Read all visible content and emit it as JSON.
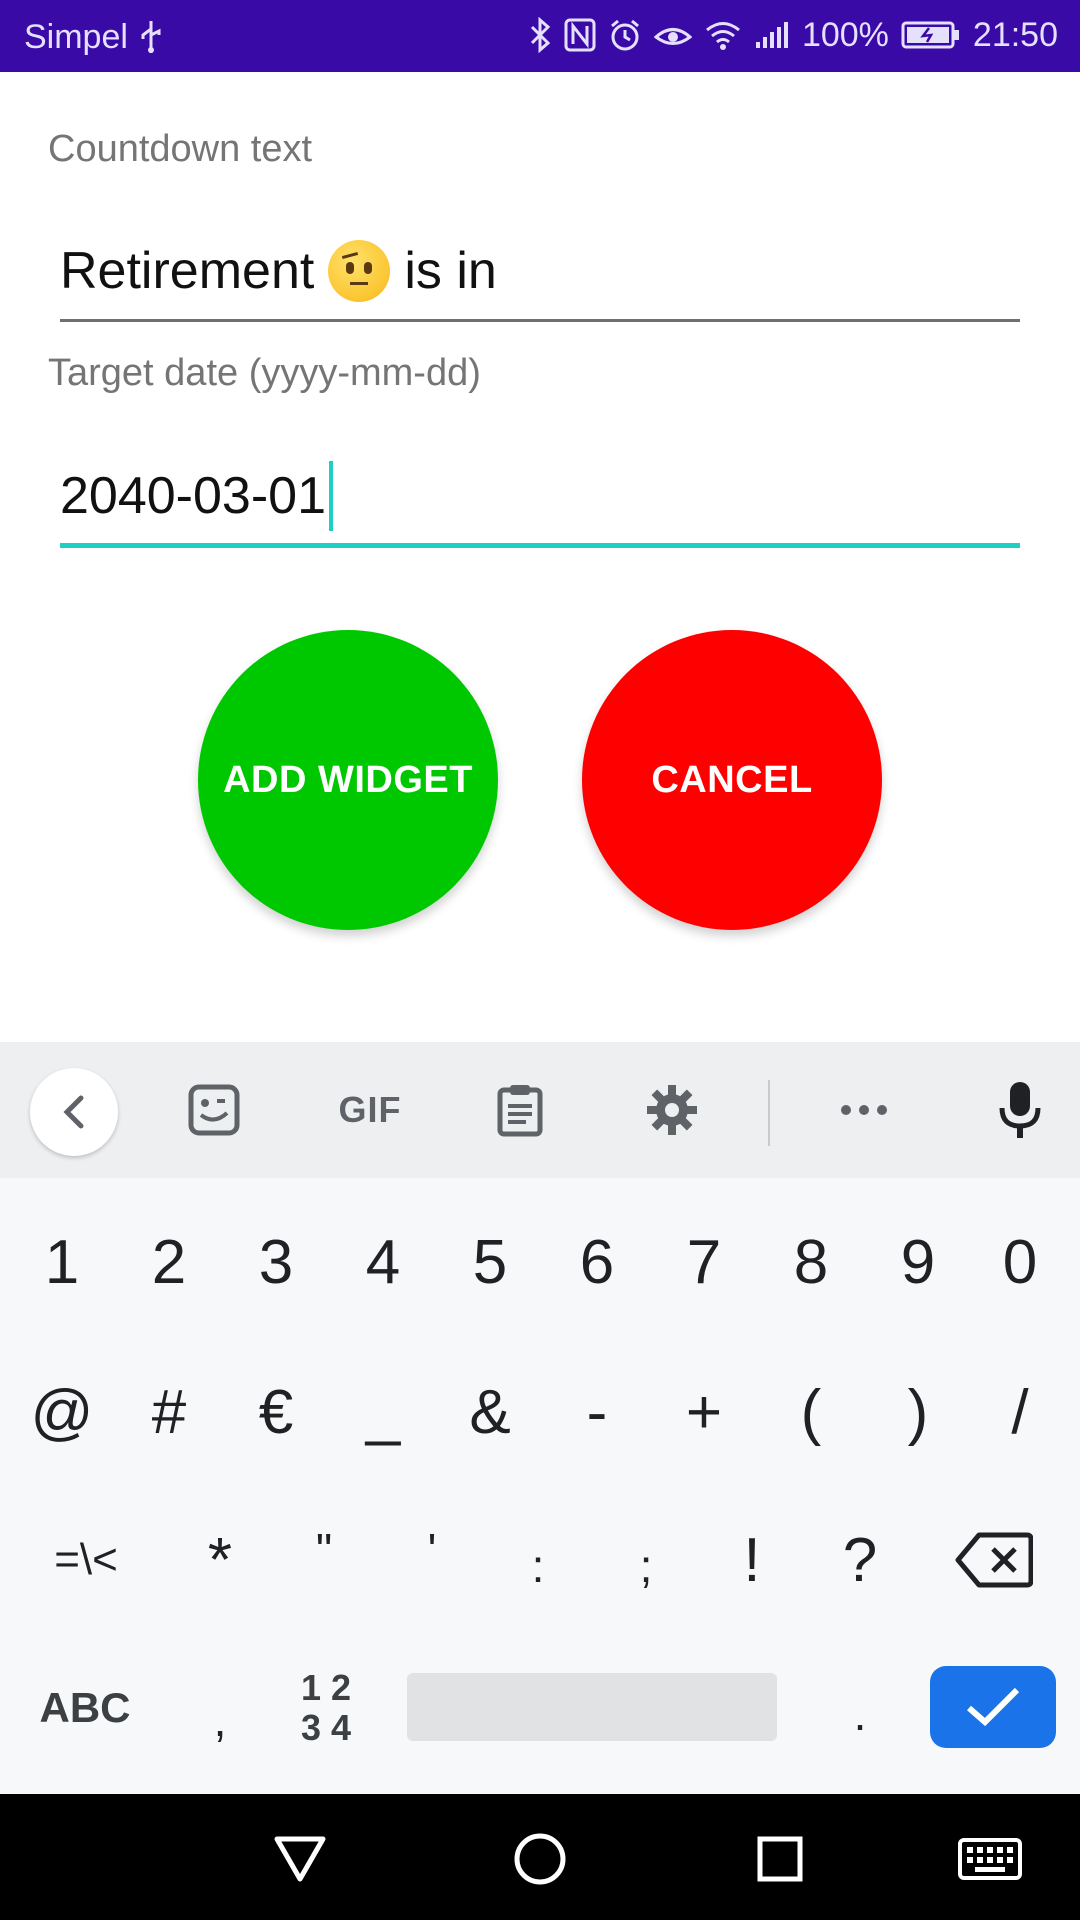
{
  "status_bar": {
    "carrier": "Simpel",
    "battery_percent": "100%",
    "time": "21:50",
    "icons": [
      "usb-icon",
      "bluetooth-icon",
      "nfc-icon",
      "alarm-icon",
      "eye-comfort-icon",
      "wifi-icon",
      "signal-icon",
      "battery-icon"
    ]
  },
  "form": {
    "countdown_label": "Countdown text",
    "countdown_value_before": "Retirement",
    "countdown_emoji": "face-with-raised-eyebrow",
    "countdown_value_after": "is in",
    "date_label": "Target date (yyyy-mm-dd)",
    "date_value": "2040-03-01"
  },
  "buttons": {
    "add_widget": "ADD WIDGET",
    "cancel": "CANCEL",
    "add_color": "#00c800",
    "cancel_color": "#ff0000"
  },
  "keyboard": {
    "toolbar": {
      "gif": "GIF",
      "icons": [
        "back-icon",
        "sticker-icon",
        "gif-icon",
        "clipboard-icon",
        "settings-icon",
        "more-icon",
        "mic-icon"
      ]
    },
    "row1": [
      "1",
      "2",
      "3",
      "4",
      "5",
      "6",
      "7",
      "8",
      "9",
      "0"
    ],
    "row2": [
      "@",
      "#",
      "€",
      "_",
      "&",
      "-",
      "+",
      "(",
      ")",
      "/"
    ],
    "row3": [
      "=\\<",
      "*",
      "\"",
      "'",
      ":",
      ";",
      "!",
      "?"
    ],
    "row4": {
      "abc": "ABC",
      "comma": ",",
      "nums_top": "1 2",
      "nums_bottom": "3 4",
      "period": "."
    },
    "enter_color": "#1a73e8"
  },
  "nav_bar": {
    "icons": [
      "back-triangle-icon",
      "home-circle-icon",
      "recents-square-icon",
      "keyboard-switch-icon"
    ]
  }
}
